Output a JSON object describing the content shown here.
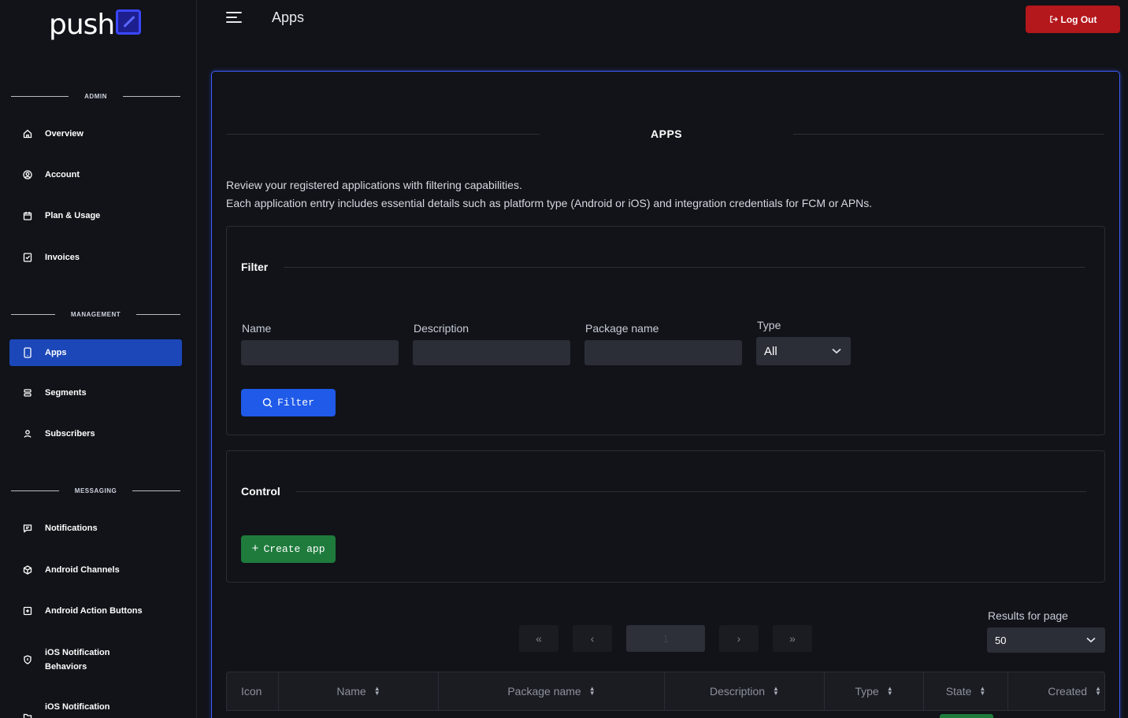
{
  "app": {
    "logo_text": "push",
    "page_title": "Apps",
    "logout_label": "Log Out"
  },
  "sidebar": {
    "sections": {
      "admin": "ADMIN",
      "management": "MANAGEMENT",
      "messaging": "MESSAGING"
    },
    "items": [
      {
        "label": "Overview",
        "icon": "home-icon"
      },
      {
        "label": "Account",
        "icon": "user-circle-icon"
      },
      {
        "label": "Plan & Usage",
        "icon": "calendar-icon"
      },
      {
        "label": "Invoices",
        "icon": "receipt-icon"
      },
      {
        "label": "Apps",
        "icon": "smartphone-icon",
        "active": true
      },
      {
        "label": "Segments",
        "icon": "stack-icon"
      },
      {
        "label": "Subscribers",
        "icon": "users-icon"
      },
      {
        "label": "Notifications",
        "icon": "message-icon"
      },
      {
        "label": "Android Channels",
        "icon": "box-icon"
      },
      {
        "label": "Android Action Buttons",
        "icon": "plus-square-icon"
      },
      {
        "label": "iOS Notification",
        "label2": "Behaviors",
        "icon": "shield-icon"
      },
      {
        "label": "iOS Notification",
        "icon": "folder-icon"
      }
    ]
  },
  "main": {
    "card_title": "APPS",
    "intro_line1": "Review your registered applications with filtering capabilities.",
    "intro_line2": "Each application entry includes essential details such as platform type (Android or iOS) and integration credentials for FCM or APNs.",
    "filter": {
      "title": "Filter",
      "name_label": "Name",
      "description_label": "Description",
      "package_label": "Package name",
      "type_label": "Type",
      "type_value": "All",
      "button_label": "Filter"
    },
    "control": {
      "title": "Control",
      "create_label": "Create app"
    },
    "pagination": {
      "first": "«",
      "prev": "‹",
      "current": "1",
      "next": "›",
      "last": "»",
      "rpp_label": "Results for page",
      "rpp_value": "50"
    },
    "table": {
      "columns": [
        "Icon",
        "Name",
        "Package name",
        "Description",
        "Type",
        "State",
        "Created"
      ]
    }
  },
  "colors": {
    "accent": "#1f5ae8",
    "danger": "#b4171c",
    "success": "#1e7b3c",
    "active_nav": "#1b47b8"
  }
}
